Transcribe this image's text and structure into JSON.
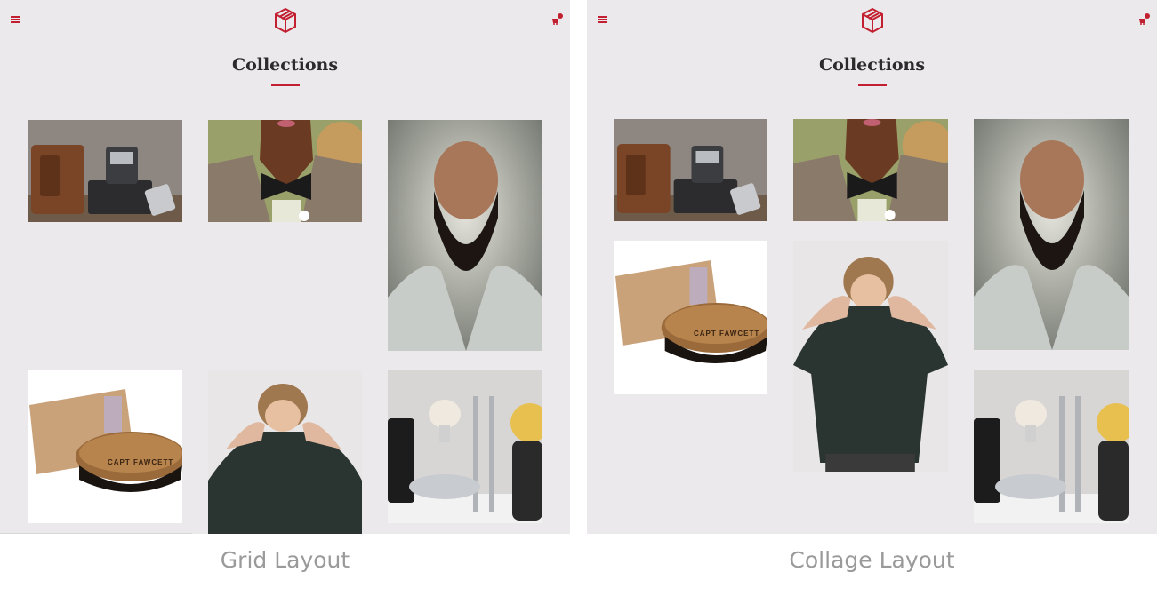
{
  "panels": [
    {
      "title": "Collections",
      "caption": "Grid Layout"
    },
    {
      "title": "Collections",
      "caption": "Collage Layout"
    }
  ],
  "icons": {
    "menu": "hamburger-menu-icon",
    "logo": "cube-logo-icon",
    "cart": "cart-icon"
  },
  "colors": {
    "accent": "#c22030",
    "panel_bg": "#ebe9eb",
    "caption": "#9a9a9a"
  },
  "photos": {
    "shaver": "shaver-with-leather-case-photo",
    "bowtie": "bearded-man-bowtie-photo",
    "portrait": "bald-bearded-man-portrait-photo",
    "brush": "capt-fawcett-beard-brush-photo",
    "tshirt": "man-pulling-tshirt-photo",
    "shaving_set": "shaving-brush-razor-set-photo"
  },
  "brush_label": "CAPT FAWCETT"
}
